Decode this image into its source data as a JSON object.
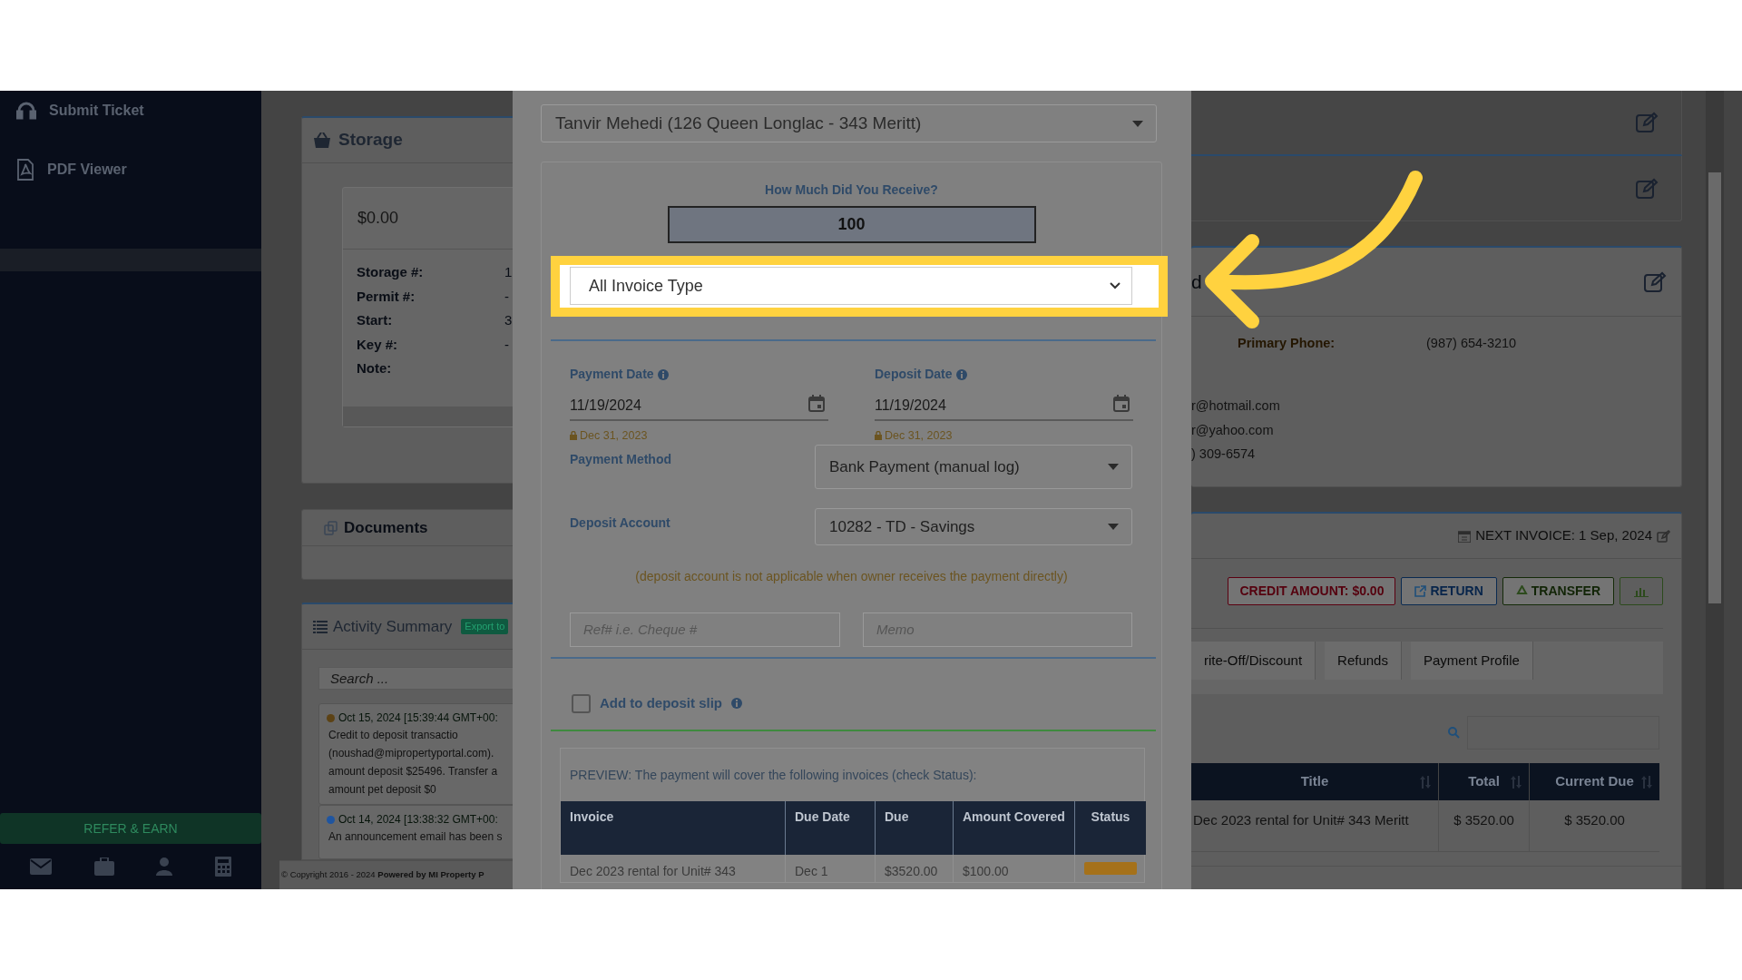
{
  "sidebar": {
    "items": [
      {
        "label": "Submit Ticket"
      },
      {
        "label": "PDF Viewer"
      }
    ],
    "refer_button": "REFER & EARN"
  },
  "storage_card": {
    "title": "Storage",
    "amount": "$0.00",
    "fields": [
      {
        "label": "Storage #:",
        "value": "1"
      },
      {
        "label": "Permit #:",
        "value": "-"
      },
      {
        "label": "Start:",
        "value": "3"
      },
      {
        "label": "Key #:",
        "value": "-"
      },
      {
        "label": "Note:"
      }
    ]
  },
  "documents_card": {
    "title": "Documents"
  },
  "activity_card": {
    "title": "Activity Summary",
    "export_button": "Export to",
    "search_placeholder": "Search ...",
    "entries": [
      {
        "time": "Oct 15, 2024 [15:39:44 GMT+00:",
        "color": "#5c4214",
        "lines": [
          "Credit to deposit transactio",
          "(noushad@mipropertyportal.com).",
          "amount deposit $25496. Transfer a",
          "amount pet deposit $0"
        ]
      },
      {
        "time": "Oct 14, 2024 [13:38:32 GMT+00:",
        "color": "#1f55a0",
        "lines": [
          "An announcement email has been s"
        ]
      }
    ]
  },
  "footer": "© Copyright 2016 - 2024 **Powered by MI Property P**",
  "modal": {
    "tenant_select": "Tanvir Mehedi (126 Queen Longlac - 343 Meritt)",
    "amount_label": "How Much Did You Receive?",
    "amount_value": "100",
    "invoice_type": "All Invoice Type",
    "dates": [
      {
        "label": "Payment Date",
        "value": "11/19/2024",
        "lock_note": "Dec 31, 2023"
      },
      {
        "label": "Deposit Date",
        "value": "11/19/2024",
        "lock_note": "Dec 31, 2023"
      }
    ],
    "payment_method": {
      "label": "Payment Method",
      "value": "Bank Payment (manual log)"
    },
    "deposit_account": {
      "label": "Deposit Account",
      "value": "10282 - TD - Savings"
    },
    "note": "(deposit account is not applicable when owner receives the payment directly)",
    "ref_placeholder": "Ref# i.e. Cheque #",
    "memo_placeholder": "Memo",
    "deposit_slip": {
      "label": "Add to deposit slip",
      "checked": false
    },
    "preview": {
      "caption": "PREVIEW: The payment will cover the following invoices (check Status):",
      "columns": [
        "Invoice",
        "Due Date",
        "Due",
        "Amount Covered",
        "Status"
      ],
      "rows": [
        {
          "cells": [
            "Dec 2023 rental for Unit# 343",
            "Dec 1",
            "$3520.00",
            "$100.00"
          ]
        }
      ]
    }
  },
  "contact_card": {
    "heading": "d",
    "fields": [
      {
        "label": "Primary Phone:",
        "value": "(987) 654-3210"
      }
    ],
    "lines": [
      "r@hotmail.com",
      "r@yahoo.com",
      ") 309-6574"
    ]
  },
  "ledger": {
    "next_invoice": "NEXT INVOICE: 1 Sep, 2024",
    "buttons": [
      {
        "kind": "credit",
        "label": "CREDIT AMOUNT: $0.00"
      },
      {
        "kind": "return",
        "label": "RETURN"
      },
      {
        "kind": "transfer",
        "label": "TRANSFER"
      },
      {
        "kind": "chart"
      }
    ],
    "tabs": [
      {
        "label": "rite-Off/Discount",
        "selected": false
      },
      {
        "label": "Refunds",
        "selected": false
      },
      {
        "label": "Payment Profile",
        "selected": false
      }
    ],
    "columns": [
      "Title",
      "Total",
      "Current Due"
    ],
    "rows": [
      [
        "Dec 2023 rental for Unit# 343 Meritt",
        "$ 3520.00",
        "$ 3520.00"
      ]
    ]
  }
}
